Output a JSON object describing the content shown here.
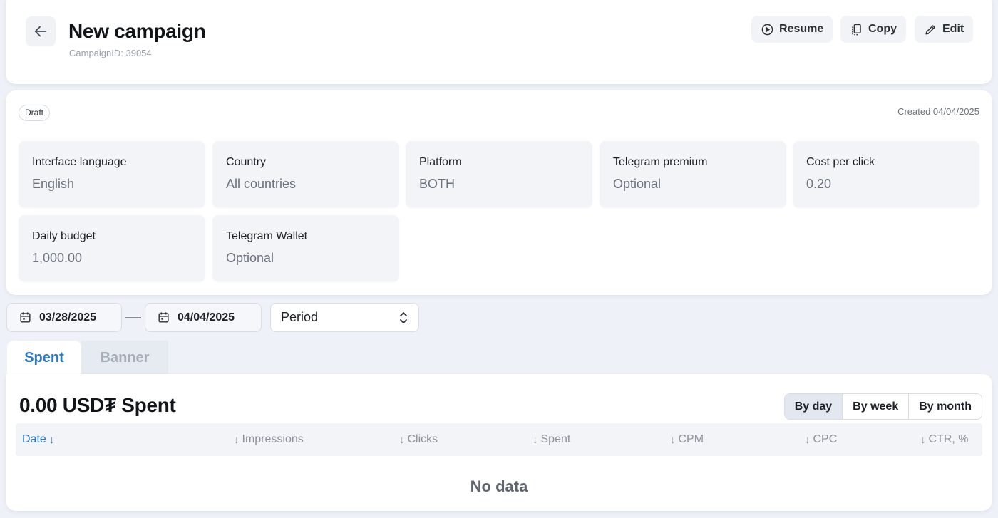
{
  "header": {
    "title": "New campaign",
    "campaign_id": "CampaignID: 39054",
    "actions": {
      "resume": "Resume",
      "copy": "Copy",
      "edit": "Edit"
    }
  },
  "info": {
    "status": "Draft",
    "created": "Created 04/04/2025",
    "fields": [
      {
        "label": "Interface language",
        "value": "English"
      },
      {
        "label": "Country",
        "value": "All countries"
      },
      {
        "label": "Platform",
        "value": "BOTH"
      },
      {
        "label": "Telegram premium",
        "value": "Optional"
      },
      {
        "label": "Cost per click",
        "value": "0.20"
      },
      {
        "label": "Daily budget",
        "value": "1,000.00"
      },
      {
        "label": "Telegram Wallet",
        "value": "Optional"
      }
    ]
  },
  "filters": {
    "date_from": "03/28/2025",
    "separator": "—",
    "date_to": "04/04/2025",
    "period": "Period"
  },
  "tabs": [
    {
      "label": "Spent",
      "active": true
    },
    {
      "label": "Banner",
      "active": false
    }
  ],
  "stats": {
    "total": "0.00 USD₮ Spent",
    "granularity": [
      "By day",
      "By week",
      "By month"
    ],
    "selected_granularity": "By day",
    "columns": [
      "Date",
      "Impressions",
      "Clicks",
      "Spent",
      "CPM",
      "CPC",
      "CTR, %"
    ],
    "sort_arrow": "↓",
    "empty": "No data"
  },
  "colors": {
    "accent": "#2f77c1",
    "background": "#eef1f7",
    "tile": "#f2f4f8"
  }
}
